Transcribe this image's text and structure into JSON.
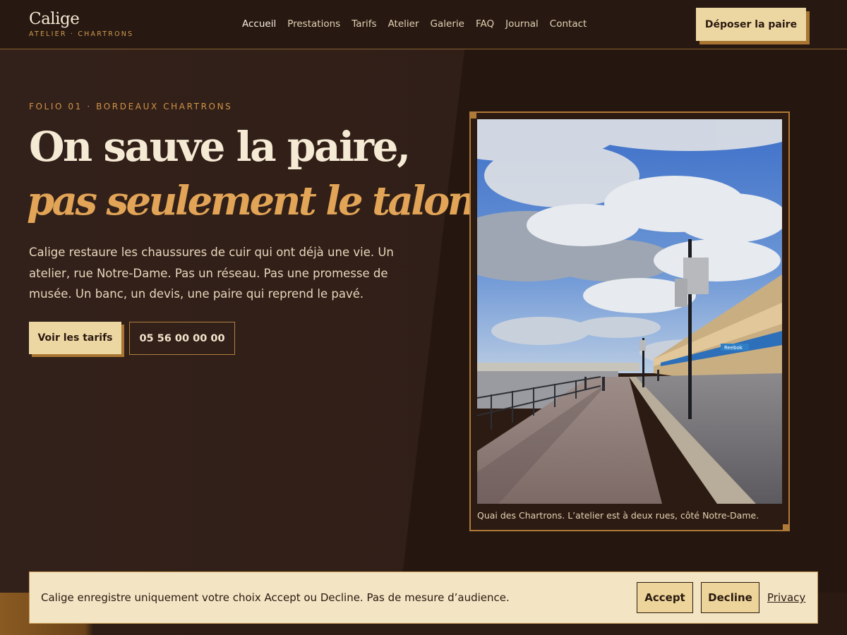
{
  "brand": {
    "name": "Calige",
    "tagline": "ATELIER · CHARTRONS"
  },
  "nav": {
    "items": [
      {
        "label": "Accueil",
        "active": true
      },
      {
        "label": "Prestations"
      },
      {
        "label": "Tarifs"
      },
      {
        "label": "Atelier"
      },
      {
        "label": "Galerie"
      },
      {
        "label": "FAQ"
      },
      {
        "label": "Journal"
      },
      {
        "label": "Contact"
      }
    ],
    "cta_label": "Déposer la paire"
  },
  "hero": {
    "eyebrow": "FOLIO 01 · BORDEAUX CHARTRONS",
    "title_line1": "On sauve la paire,",
    "title_line2": "pas seulement le talon",
    "title_punct": ".",
    "lede": "Calige restaure les chaussures de cuir qui ont déjà une vie. Un atelier, rue Notre-Dame. Pas un réseau. Pas une promesse de musée. Un banc, un devis, une paire qui reprend le pavé.",
    "primary_cta": "Voir les tarifs",
    "phone_cta": "05 56 00 00 00"
  },
  "photo": {
    "caption": "Quai des Chartrons. L’atelier est à deux rues, côté Notre-Dame.",
    "shop_sign": "Reebok"
  },
  "cookie": {
    "text": "Calige enregistre uniquement votre choix Accept ou Decline. Pas de mesure d’audience.",
    "accept_label": "Accept",
    "decline_label": "Decline",
    "privacy_label": "Privacy"
  },
  "colors": {
    "background": "#2e1d14",
    "accent": "#e2a456",
    "button": "#ecd6a2",
    "button_shadow": "#a87532"
  }
}
